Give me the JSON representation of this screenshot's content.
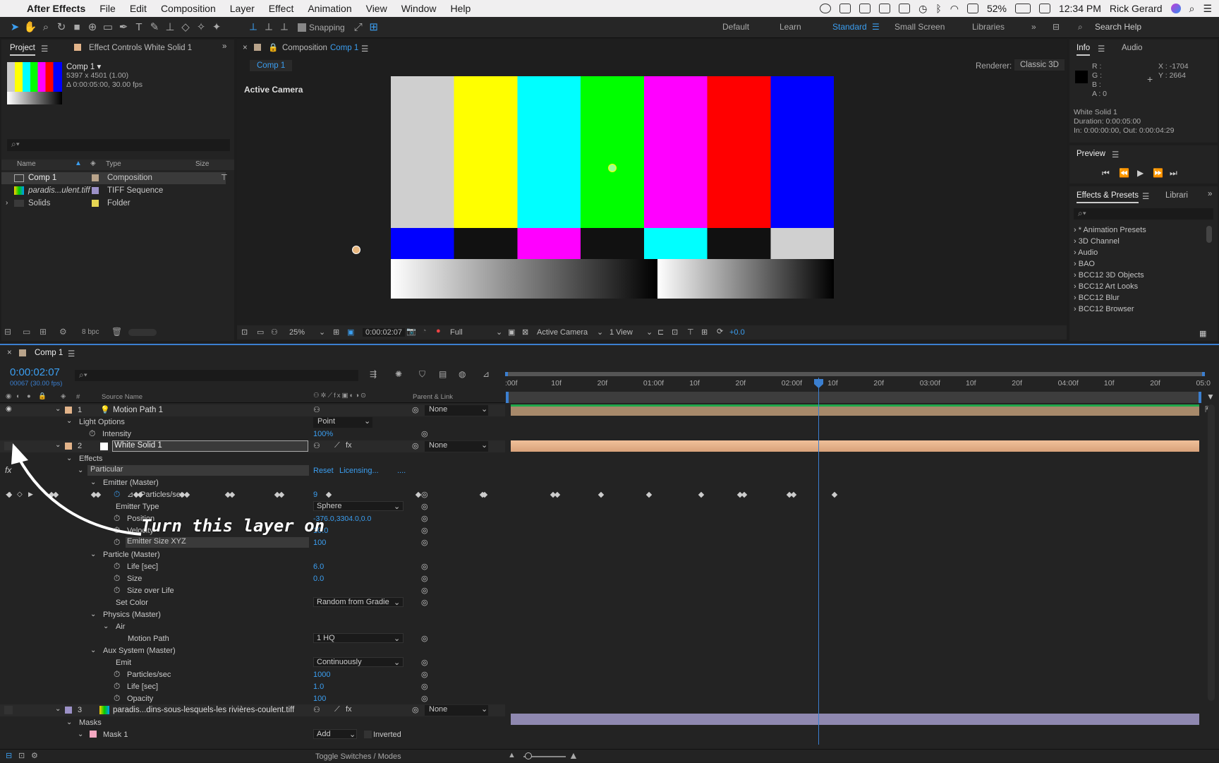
{
  "menubar": {
    "app": "After Effects",
    "items": [
      "File",
      "Edit",
      "Composition",
      "Layer",
      "Effect",
      "Animation",
      "View",
      "Window",
      "Help"
    ],
    "battery": "52%",
    "time": "12:34 PM",
    "user": "Rick Gerard"
  },
  "toolbar": {
    "snapping": "Snapping",
    "workspaces": [
      "Default",
      "Learn",
      "Standard",
      "Small Screen",
      "Libraries"
    ],
    "search_help": "Search Help"
  },
  "project": {
    "tab": "Project",
    "effect_controls": "Effect Controls White Solid 1",
    "comp_name": "Comp 1 ▾",
    "comp_size": "5397 x 4501 (1.00)",
    "comp_duration": "Δ 0:00:05:00, 30.00 fps",
    "cols": {
      "name": "Name",
      "type": "Type",
      "size": "Size"
    },
    "items": [
      {
        "name": "Comp 1",
        "type": "Composition",
        "color": "#b8a38a"
      },
      {
        "name": "paradis...ulent.tiff",
        "type": "TIFF Sequence",
        "color": "#9c91c7"
      },
      {
        "name": "Solids",
        "type": "Folder",
        "color": "#e5d553"
      }
    ],
    "bpc": "8 bpc"
  },
  "comp": {
    "tab_prefix": "Composition",
    "tab_name": "Comp 1",
    "sub_tab": "Comp 1",
    "renderer_label": "Renderer:",
    "renderer": "Classic 3D",
    "camera_label": "Active Camera",
    "footer": {
      "zoom": "25%",
      "time": "0:00:02:07",
      "res": "Full",
      "camera": "Active Camera",
      "views": "1 View",
      "exposure": "+0.0"
    }
  },
  "info": {
    "tab": "Info",
    "audio": "Audio",
    "r": "R :",
    "g": "G :",
    "b": "B :",
    "a": "A :  0",
    "x": "X : -1704",
    "y": "Y :  2664",
    "layer": "White Solid 1",
    "duration": "Duration: 0:00:05:00",
    "inout": "In: 0:00:00:00, Out: 0:00:04:29"
  },
  "preview": {
    "tab": "Preview"
  },
  "effects": {
    "tab": "Effects & Presets",
    "libs": "Librari",
    "items": [
      "* Animation Presets",
      "3D Channel",
      "Audio",
      "BAO",
      "BCC12 3D Objects",
      "BCC12 Art Looks",
      "BCC12 Blur",
      "BCC12 Browser"
    ]
  },
  "timeline": {
    "tab": "Comp 1",
    "timecode": "0:00:02:07",
    "frames": "00067 (30.00 fps)",
    "col_num": "#",
    "col_source": "Source Name",
    "col_parent": "Parent & Link",
    "toggle": "Toggle Switches / Modes",
    "ruler": [
      ":00f",
      "10f",
      "20f",
      "01:00f",
      "10f",
      "20f",
      "02:00f",
      "10f",
      "20f",
      "03:00f",
      "10f",
      "20f",
      "04:00f",
      "10f",
      "20f",
      "05:0"
    ]
  },
  "layers": {
    "l1": {
      "num": "1",
      "name": "Motion Path 1",
      "parent": "None",
      "light_options": "Light Options",
      "light_type": "Point",
      "intensity": "Intensity",
      "intensity_val": "100%"
    },
    "l2": {
      "num": "2",
      "name": "White Solid 1",
      "parent": "None",
      "effects": "Effects",
      "particular": "Particular",
      "reset": "Reset",
      "licensing": "Licensing...",
      "dots": "....",
      "emitter": "Emitter (Master)",
      "particles_sec": "Particles/sec",
      "particles_val": "9",
      "emitter_type": "Emitter Type",
      "emitter_type_val": "Sphere",
      "position": "Position",
      "position_val": "-376.0,3304.0,0.0",
      "velocity": "Velocity",
      "velocity_val": "10.0",
      "emitter_size": "Emitter Size XYZ",
      "emitter_size_val": "100",
      "particle": "Particle (Master)",
      "life": "Life [sec]",
      "life_val": "6.0",
      "size": "Size",
      "size_val": "0.0",
      "size_over_life": "Size over Life",
      "set_color": "Set Color",
      "set_color_val": "Random from Gradie",
      "physics": "Physics (Master)",
      "air": "Air",
      "motion_path": "Motion Path",
      "motion_path_val": "1 HQ",
      "aux": "Aux System (Master)",
      "emit": "Emit",
      "emit_val": "Continuously",
      "aux_particles": "Particles/sec",
      "aux_particles_val": "1000",
      "aux_life": "Life [sec]",
      "aux_life_val": "1.0",
      "opacity": "Opacity",
      "opacity_val": "100"
    },
    "l3": {
      "num": "3",
      "name": "paradis...dins-sous-lesquels-les rivières-coulent.tiff",
      "parent": "None",
      "masks": "Masks",
      "mask1": "Mask 1",
      "mode": "Add",
      "inverted": "Inverted"
    }
  },
  "annotation": {
    "text": "Turn this layer on"
  }
}
